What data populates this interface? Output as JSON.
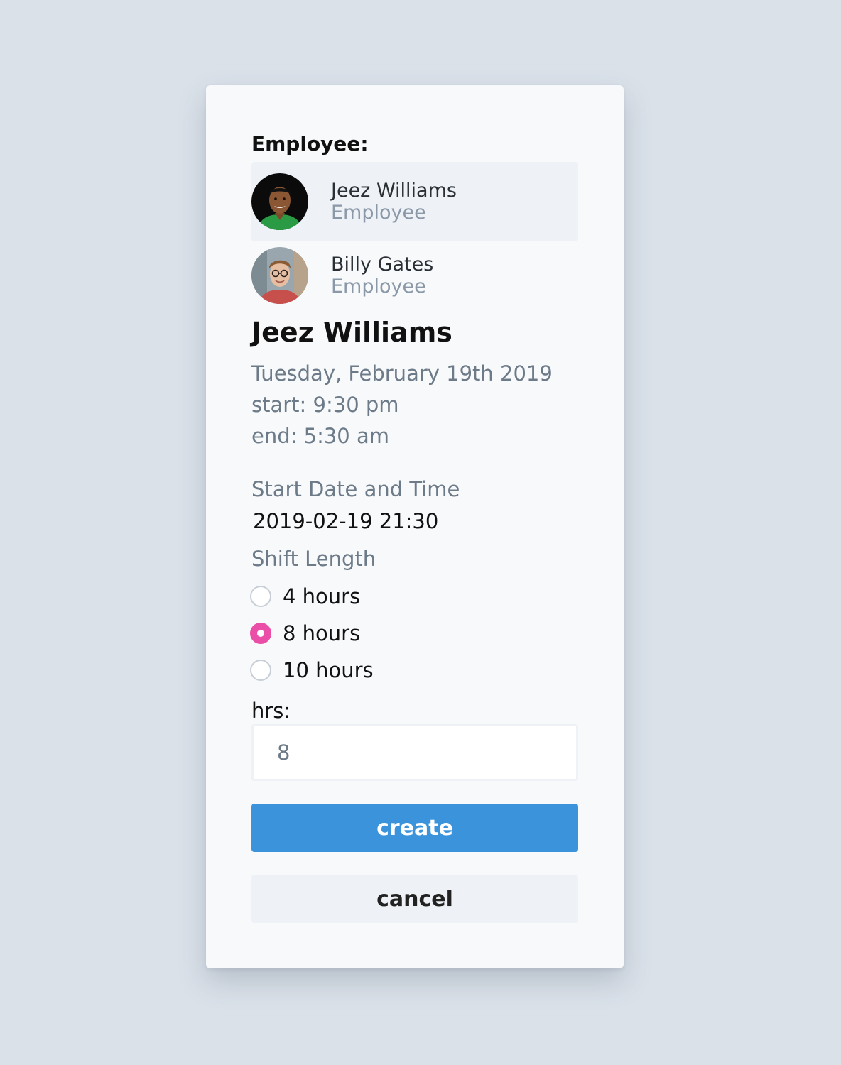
{
  "form": {
    "employee_label": "Employee:",
    "employees": [
      {
        "name": "Jeez Williams",
        "role": "Employee",
        "selected": true
      },
      {
        "name": "Billy Gates",
        "role": "Employee",
        "selected": false
      }
    ],
    "selected_employee_name": "Jeez Williams",
    "shift": {
      "date": "Tuesday, February 19th 2019",
      "start": "start: 9:30 pm",
      "end": "end: 5:30 am"
    },
    "start_datetime_label": "Start Date and Time",
    "start_datetime_value": "2019-02-19 21:30",
    "shift_length_label": "Shift Length",
    "shift_length_options": [
      {
        "label": "4 hours",
        "checked": false
      },
      {
        "label": "8 hours",
        "checked": true
      },
      {
        "label": "10 hours",
        "checked": false
      }
    ],
    "hrs_label": "hrs:",
    "hrs_value": "8",
    "create_label": "create",
    "cancel_label": "cancel"
  },
  "colors": {
    "background": "#dae1e9",
    "card": "#f7f9fb",
    "accent": "#3b93db",
    "radio_checked": "#ea4ea6",
    "muted_text": "#6d7a88"
  }
}
